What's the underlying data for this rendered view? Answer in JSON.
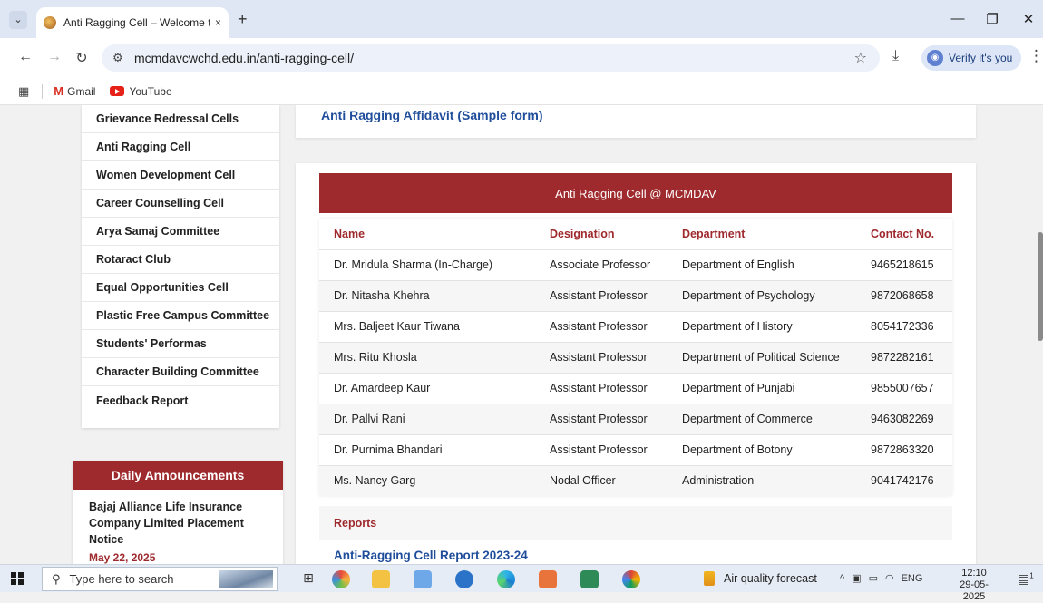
{
  "browser": {
    "tab_title": "Anti Ragging Cell – Welcome to",
    "tab_close": "×",
    "new_tab": "+",
    "url": "mcmdavcwchd.edu.in/anti-ragging-cell/",
    "verify_label": "Verify it's you",
    "bookmarks": [
      {
        "label": "Gmail",
        "icon": "gmail-icon"
      },
      {
        "label": "YouTube",
        "icon": "youtube-icon"
      }
    ]
  },
  "sidebar": {
    "items": [
      "Grievance Redressal Cells",
      "Anti Ragging Cell",
      "Women Development Cell",
      "Career Counselling Cell",
      "Arya Samaj Committee",
      "Rotaract Club",
      "Equal Opportunities Cell",
      "Plastic Free Campus Committee",
      "Students' Performas",
      "Character Building Committee",
      "Feedback Report"
    ]
  },
  "announcements": {
    "heading": "Daily Announcements",
    "title": "Bajaj Alliance Life Insurance Company Limited Placement Notice",
    "date": "May 22, 2025"
  },
  "main": {
    "affidavit_link": "Anti Ragging Affidavit (Sample form)",
    "table_title": "Anti Ragging Cell @ MCMDAV",
    "columns": [
      "Name",
      "Designation",
      "Department",
      "Contact No."
    ],
    "rows": [
      [
        "Dr. Mridula Sharma (In-Charge)",
        "Associate Professor",
        "Department of English",
        "9465218615"
      ],
      [
        "Dr. Nitasha Khehra",
        "Assistant Professor",
        "Department of Psychology",
        "9872068658"
      ],
      [
        "Mrs. Baljeet Kaur Tiwana",
        "Assistant Professor",
        "Department of History",
        "8054172336"
      ],
      [
        "Mrs. Ritu Khosla",
        "Assistant Professor",
        "Department of Political Science",
        "9872282161"
      ],
      [
        "Dr. Amardeep Kaur",
        "Assistant Professor",
        "Department of Punjabi",
        "9855007657"
      ],
      [
        "Dr. Pallvi Rani",
        "Assistant Professor",
        "Department of Commerce",
        "9463082269"
      ],
      [
        "Dr. Purnima Bhandari",
        "Assistant Professor",
        "Department of Botony",
        "9872863320"
      ],
      [
        "Ms. Nancy Garg",
        "Nodal Officer",
        "Administration",
        "9041742176"
      ]
    ],
    "reports_heading": "Reports",
    "report_link": "Anti-Ragging Cell Report 2023-24"
  },
  "taskbar": {
    "search_placeholder": "Type here to search",
    "weather": "Air quality forecast",
    "language": "ENG",
    "time": "12:10",
    "date": "29-05-2025",
    "notification_count": "1"
  },
  "colors": {
    "accent": "#9f2a2e",
    "link": "#1f4d9b"
  }
}
